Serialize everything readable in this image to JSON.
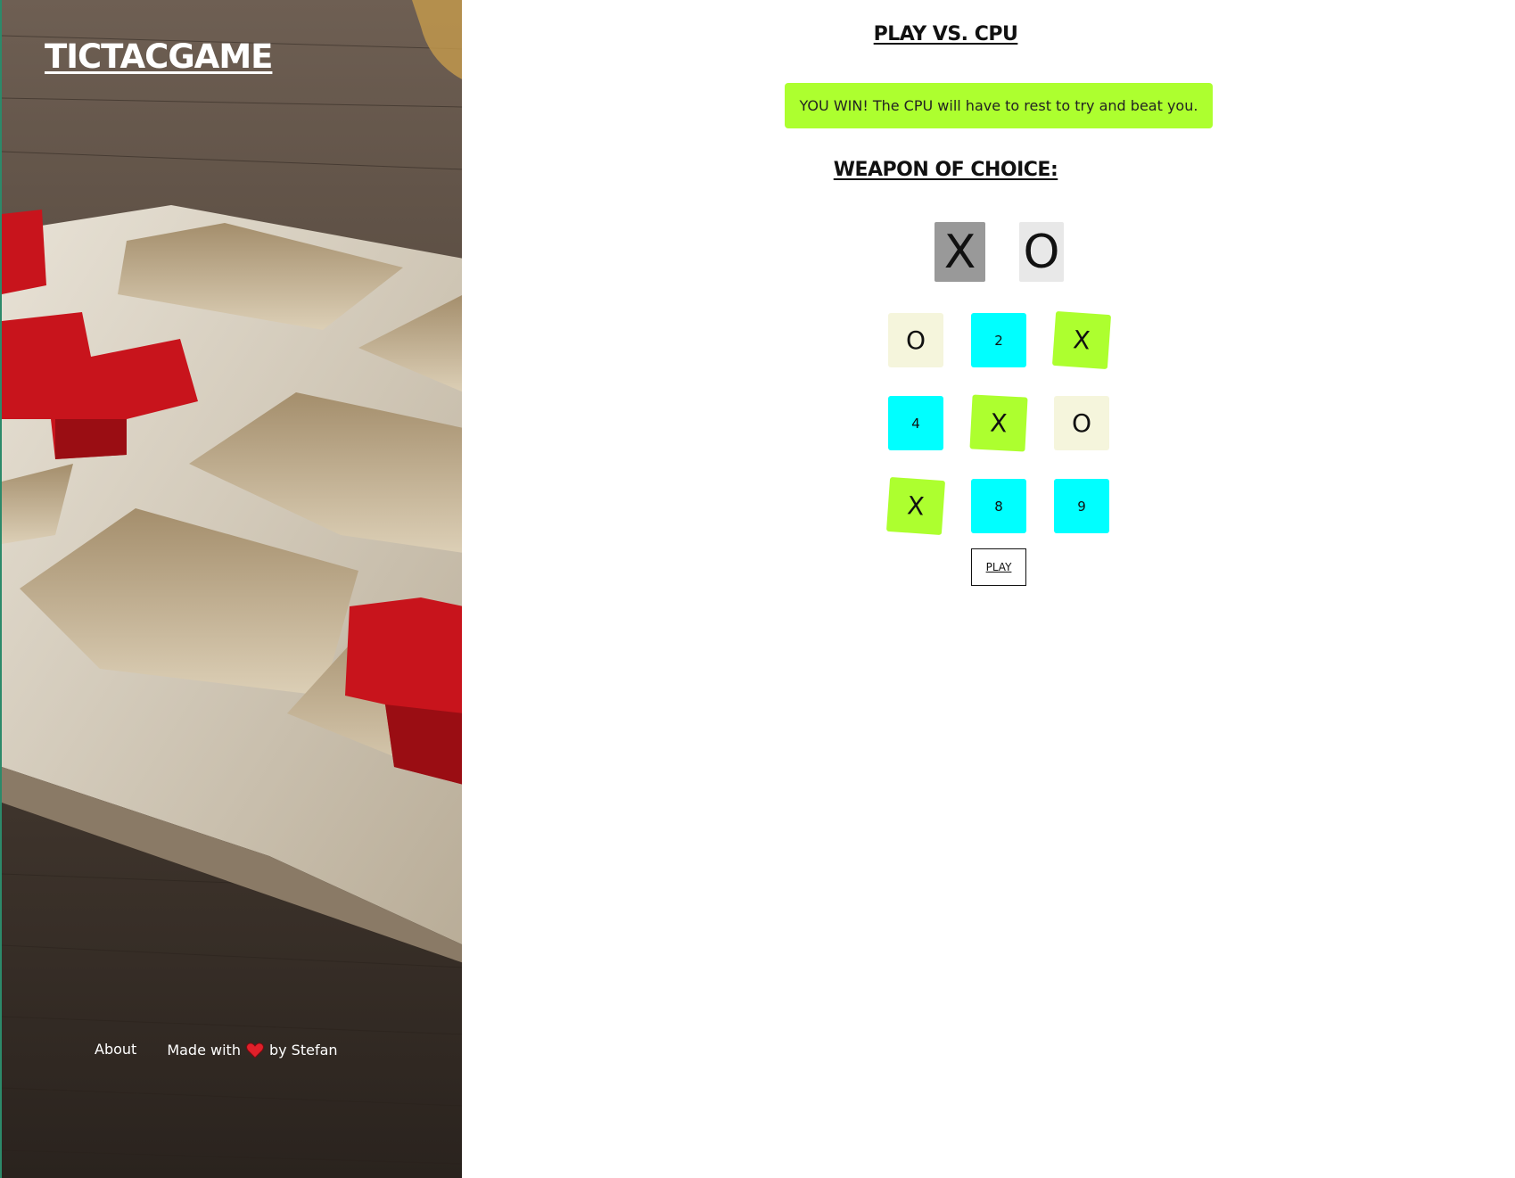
{
  "site": {
    "title": "TICTACGAME"
  },
  "footer": {
    "about": "About",
    "made_with": "Made with",
    "by": "by Stefan",
    "heart_icon": "heart-icon"
  },
  "game": {
    "mode_heading": "PLAY VS. CPU",
    "result_message": "YOU WIN! The CPU will have to rest to try and beat you.",
    "weapon_heading": "WEAPON OF CHOICE:",
    "weapons": {
      "x": "X",
      "o": "O",
      "selected": "X"
    },
    "board": [
      "O",
      "2",
      "X",
      "4",
      "X",
      "O",
      "X",
      "8",
      "9"
    ],
    "play_label": "PLAY"
  },
  "colors": {
    "x_cell": "#adff2f",
    "o_cell": "#f5f5dc",
    "empty_cell": "#00ffff",
    "result_banner": "#adff2f",
    "weapon_selected": "#999999",
    "weapon_unselected": "#e8e8e8"
  }
}
